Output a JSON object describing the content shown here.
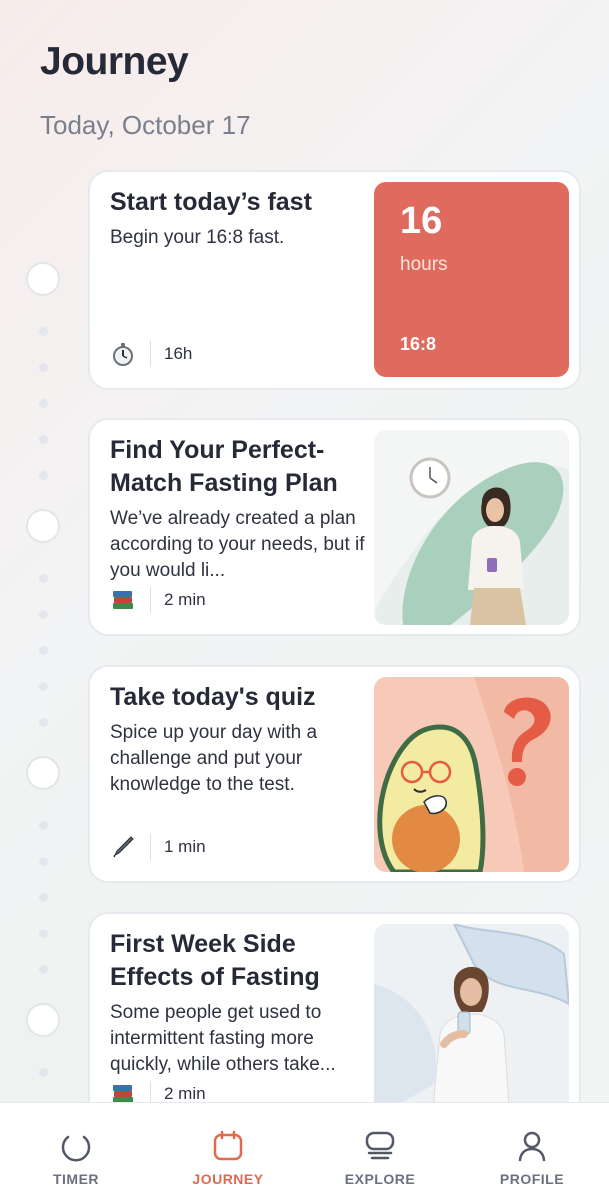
{
  "header": {
    "title": "Journey",
    "date": "Today, October 17"
  },
  "cards": [
    {
      "title": "Start today’s fast",
      "description": "Begin your 16:8 fast.",
      "meta_icon": "stopwatch-icon",
      "meta_text": "16h",
      "fast": {
        "hours": "16",
        "unit": "hours",
        "plan": "16:8"
      },
      "accent_color": "#de6b5e"
    },
    {
      "title": "Find Your Perfect-Match Fasting Plan",
      "description": "We’ve already created a plan according to your needs, but if you would li...",
      "meta_icon": "books-icon",
      "meta_text": "2 min",
      "image": "woman-with-phone-illustration"
    },
    {
      "title": "Take today's quiz",
      "description": "Spice up your day with a challenge and put your knowledge to the test.",
      "meta_icon": "pen-icon",
      "meta_text": "1 min",
      "image": "avocado-question-illustration"
    },
    {
      "title": "First Week Side Effects of Fasting",
      "description": "Some people get used to intermittent fasting more quickly, while others take...",
      "meta_icon": "books-icon",
      "meta_text": "2 min",
      "image": "woman-drinking-water-photo"
    }
  ],
  "nav": [
    {
      "label": "TIMER",
      "icon": "timer-icon",
      "active": false
    },
    {
      "label": "JOURNEY",
      "icon": "calendar-icon",
      "active": true
    },
    {
      "label": "EXPLORE",
      "icon": "explore-icon",
      "active": false
    },
    {
      "label": "PROFILE",
      "icon": "profile-icon",
      "active": false
    }
  ],
  "colors": {
    "accent": "#df6a4f",
    "fast_box": "#de6b5e",
    "text": "#262a37",
    "muted": "#7a7f8c"
  }
}
